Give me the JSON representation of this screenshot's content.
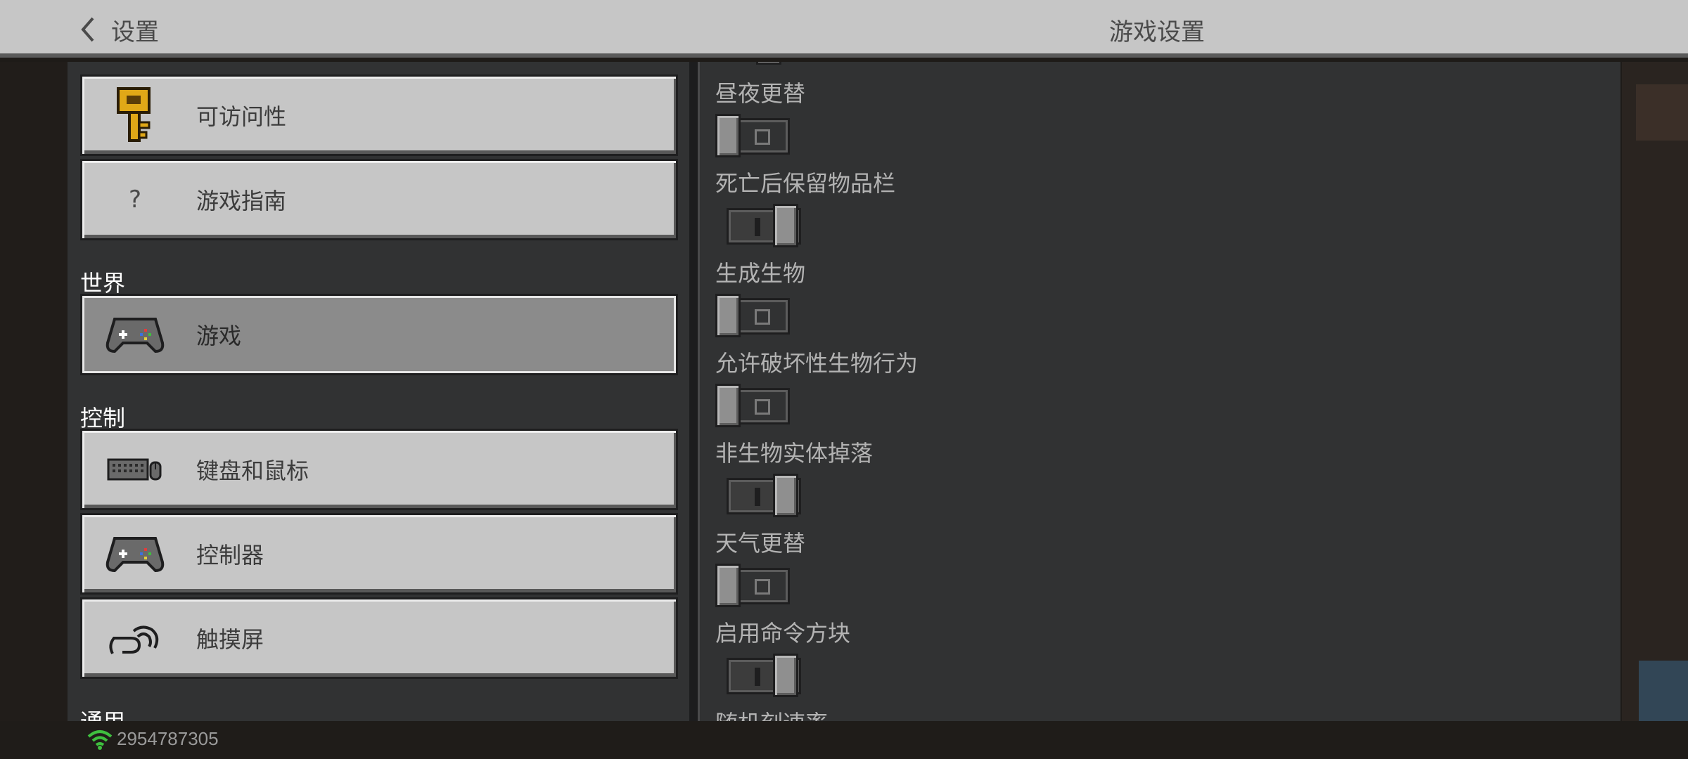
{
  "header": {
    "back_label": "设置",
    "title": "游戏设置"
  },
  "left_menu": {
    "top_items": [
      {
        "label": "可访问性",
        "icon": "key-icon"
      },
      {
        "label": "游戏指南",
        "icon": "question-mark-icon"
      }
    ],
    "sections": [
      {
        "title": "世界",
        "items": [
          {
            "label": "游戏",
            "icon": "gamepad-icon",
            "selected": true
          }
        ]
      },
      {
        "title": "控制",
        "items": [
          {
            "label": "键盘和鼠标",
            "icon": "keyboard-mouse-icon"
          },
          {
            "label": "控制器",
            "icon": "gamepad-icon"
          },
          {
            "label": "触摸屏",
            "icon": "touch-hand-icon"
          }
        ]
      },
      {
        "title": "通用",
        "items": []
      }
    ]
  },
  "settings": [
    {
      "label": "昼夜更替",
      "state": "off"
    },
    {
      "label": "死亡后保留物品栏",
      "state": "on"
    },
    {
      "label": "生成生物",
      "state": "off"
    },
    {
      "label": "允许破坏性生物行为",
      "state": "off"
    },
    {
      "label": "非生物实体掉落",
      "state": "on"
    },
    {
      "label": "天气更替",
      "state": "off"
    },
    {
      "label": "启用命令方块",
      "state": "on"
    },
    {
      "label": "随机刻速率",
      "state": ""
    }
  ],
  "status_bar": {
    "text": "2954787305",
    "icon": "wifi-icon",
    "icon_color": "#3fbf3f"
  }
}
